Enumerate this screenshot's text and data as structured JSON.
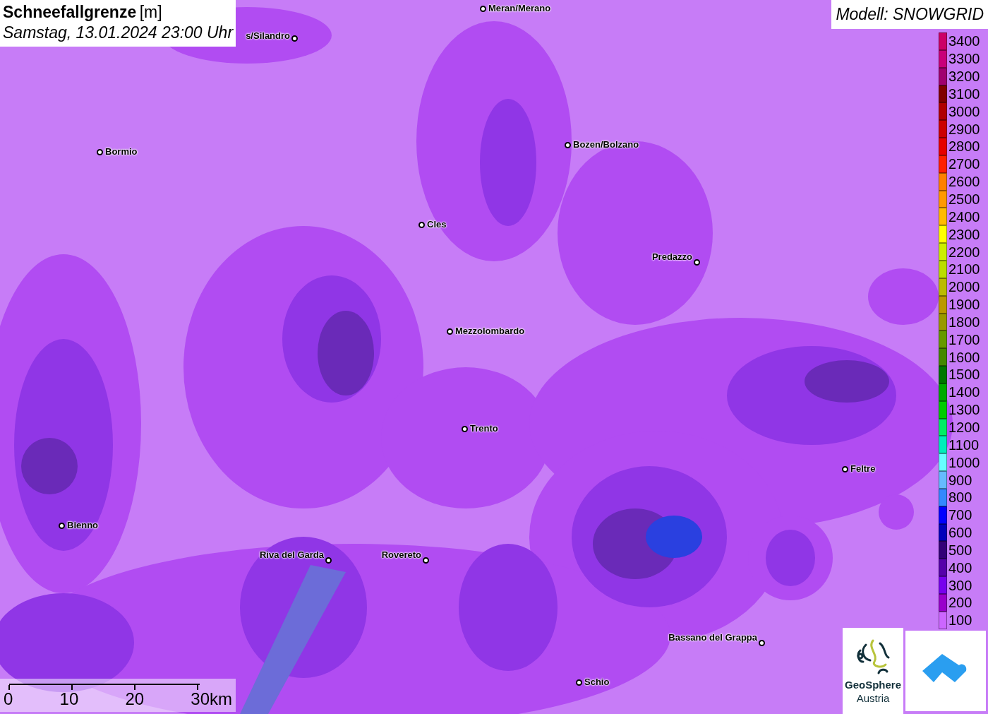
{
  "title": {
    "heading": "Schneefallgrenze",
    "unit": "[m]",
    "datetime": "Samstag, 13.01.2024 23:00 Uhr"
  },
  "model": "Modell: SNOWGRID",
  "cities": [
    {
      "name": "Meran/Merano"
    },
    {
      "name": "s/Silandro"
    },
    {
      "name": "Bormio"
    },
    {
      "name": "Bozen/Bolzano"
    },
    {
      "name": "Cles"
    },
    {
      "name": "Predazzo"
    },
    {
      "name": "Mezzolombardo"
    },
    {
      "name": "Trento"
    },
    {
      "name": "Feltre"
    },
    {
      "name": "Bienno"
    },
    {
      "name": "Riva del Garda"
    },
    {
      "name": "Rovereto"
    },
    {
      "name": "Bassano del Grappa"
    },
    {
      "name": "Schio"
    }
  ],
  "legend": [
    {
      "label": "3400",
      "color": "#cc0066"
    },
    {
      "label": "3300",
      "color": "#c8007a"
    },
    {
      "label": "3200",
      "color": "#a00070"
    },
    {
      "label": "3100",
      "color": "#800000"
    },
    {
      "label": "3000",
      "color": "#b00000"
    },
    {
      "label": "2900",
      "color": "#cc0000"
    },
    {
      "label": "2800",
      "color": "#e60000"
    },
    {
      "label": "2700",
      "color": "#ff2000"
    },
    {
      "label": "2600",
      "color": "#ff8000"
    },
    {
      "label": "2500",
      "color": "#ff9900"
    },
    {
      "label": "2400",
      "color": "#ffbb00"
    },
    {
      "label": "2300",
      "color": "#ffff00"
    },
    {
      "label": "2200",
      "color": "#ccee00"
    },
    {
      "label": "2100",
      "color": "#bbdd00"
    },
    {
      "label": "2000",
      "color": "#bbbb00"
    },
    {
      "label": "1900",
      "color": "#bb9900"
    },
    {
      "label": "1800",
      "color": "#999900"
    },
    {
      "label": "1700",
      "color": "#669900"
    },
    {
      "label": "1600",
      "color": "#448800"
    },
    {
      "label": "1500",
      "color": "#007700"
    },
    {
      "label": "1400",
      "color": "#00aa00"
    },
    {
      "label": "1300",
      "color": "#00cc00"
    },
    {
      "label": "1200",
      "color": "#00ee66"
    },
    {
      "label": "1100",
      "color": "#00eebb"
    },
    {
      "label": "1000",
      "color": "#66ffff"
    },
    {
      "label": "900",
      "color": "#66bbff"
    },
    {
      "label": "800",
      "color": "#3388ff"
    },
    {
      "label": "700",
      "color": "#0000ff"
    },
    {
      "label": "600",
      "color": "#0000bb"
    },
    {
      "label": "500",
      "color": "#330077"
    },
    {
      "label": "400",
      "color": "#5500aa"
    },
    {
      "label": "300",
      "color": "#7700ee"
    },
    {
      "label": "200",
      "color": "#9900cc"
    },
    {
      "label": "100",
      "color": "#cc66ff"
    }
  ],
  "scale_bar": {
    "ticks": [
      "0",
      "10",
      "20",
      "30km"
    ]
  },
  "logo": {
    "name": "GeoSphere",
    "sub": "Austria"
  }
}
